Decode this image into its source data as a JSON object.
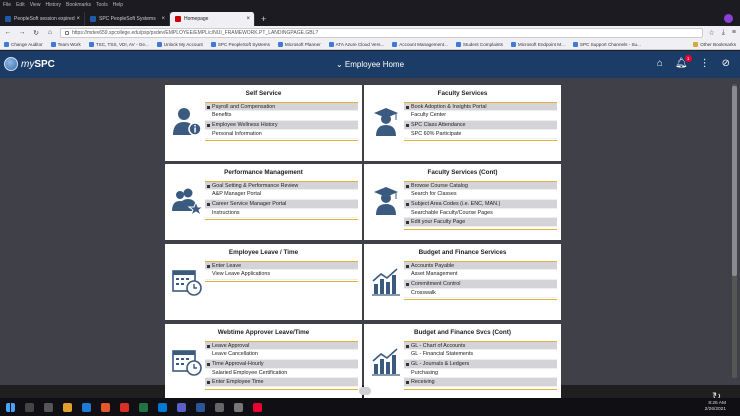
{
  "browser": {
    "menu": [
      "File",
      "Edit",
      "View",
      "History",
      "Bookmarks",
      "Tools",
      "Help"
    ],
    "tabs": [
      {
        "label": "PeopleSoft session expired"
      },
      {
        "label": "SPC PeopleSoft Systems"
      },
      {
        "label": "Homepage"
      }
    ],
    "url": "https://mdev659.spcollege.edu/psp/psdev/EMPLOYEE/EMPL/c/NUI_FRAMEWORK.PT_LANDINGPAGE.GBL?",
    "bookmarks": [
      "Change Auditor",
      "Team Work",
      "TSC, TSS, VDI, AV - Ge...",
      "Unlock My Account",
      "SPC PeopleSoft Systems",
      "Microsoft Planner",
      "ATA Azure Cloud Vers...",
      "Account Management...",
      "Student Complaints",
      "Microsoft Endpoint M...",
      "SPC Support Channels - Su..."
    ],
    "other_bookmarks": "Other Bookmarks"
  },
  "app": {
    "logo_prefix": "my",
    "logo_main": "SPC",
    "page_title": "Employee Home",
    "notification_count": "1"
  },
  "tiles": [
    {
      "title": "Self Service",
      "icon": "person-info-icon",
      "items": [
        "Payroll and Compensation",
        "Benefits",
        "Employee Wellness History",
        "Personal Information"
      ]
    },
    {
      "title": "Faculty Services",
      "icon": "graduate-icon",
      "items": [
        "Book Adoption & Insights Portal",
        "Faculty Center",
        "SPC Class Attendance",
        "SPC 60% Participate"
      ]
    },
    {
      "title": "Performance Management",
      "icon": "team-star-icon",
      "items": [
        "Goal Setting & Performance Review",
        "A&P Manager Portal",
        "Career Service Manager Portal",
        "Instructions"
      ]
    },
    {
      "title": "Faculty Services (Cont)",
      "icon": "graduate-icon",
      "items": [
        "Browse Course Catalog",
        "Search for Classes",
        "Subject Area Codes (i.e. ENC, MAN.)",
        "Searchable Faculty/Course Pages",
        "Edit your Faculty Page"
      ]
    },
    {
      "title": "Employee Leave / Time",
      "icon": "calendar-clock-icon",
      "items": [
        "Enter Leave",
        "View Leave Applications"
      ]
    },
    {
      "title": "Budget and Finance Services",
      "icon": "bar-chart-icon",
      "items": [
        "Accounts Payable",
        "Asset Management",
        "Commitment Control",
        "Crosswalk"
      ]
    },
    {
      "title": "Webtime Approver Leave/Time",
      "icon": "calendar-clock-icon",
      "items": [
        "Leave Approval",
        "Leave Cancellation",
        "Time Approval-Hourly",
        "Salaried Employee Certification",
        "Enter Employee Time"
      ]
    },
    {
      "title": "Budget and Finance Svcs (Cont)",
      "icon": "bar-chart-icon",
      "items": [
        "GL - Chart of Accounts",
        "GL - Financial Statements",
        "GL - Journals & Ledgers",
        "Purchasing",
        "Receiving"
      ]
    }
  ],
  "taskbar": {
    "time": "8:26 AM",
    "date": "2/26/2021"
  },
  "colors": {
    "header": "#1a3c66",
    "accent": "#e0b23a",
    "content_bg": "#404048"
  }
}
